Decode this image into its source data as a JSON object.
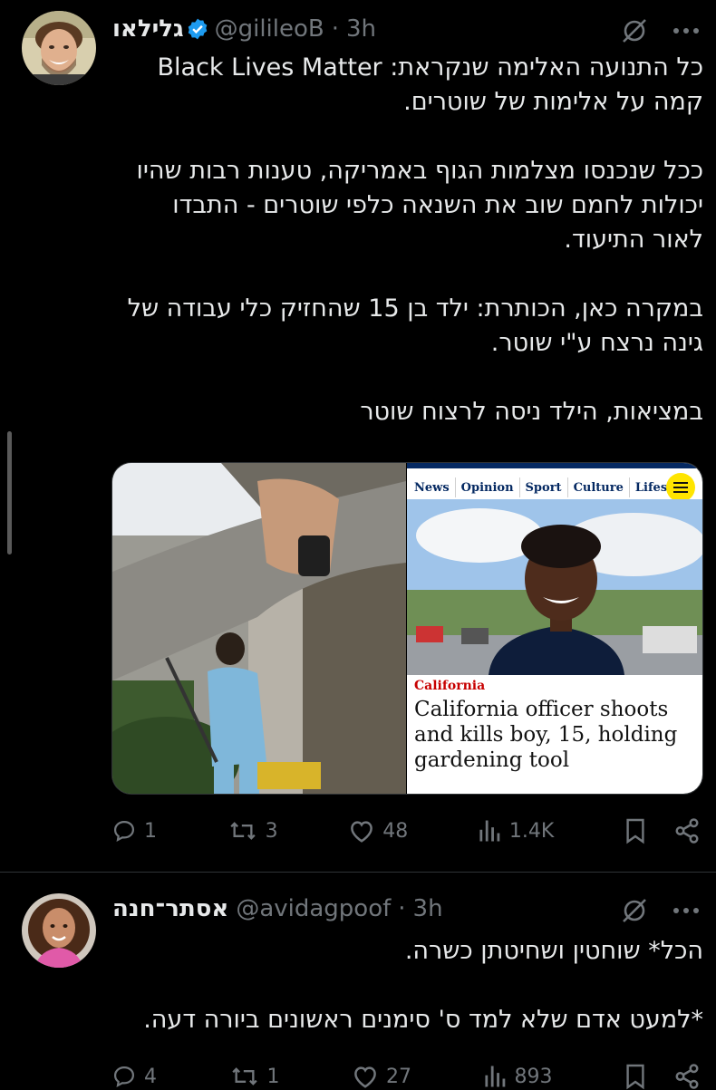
{
  "tweet1": {
    "name": "גלילאו",
    "handle": "@gilileoB",
    "separator": "·",
    "time": "3h",
    "text": "כל התנועה האלימה שנקראת: Black Lives Matter\nקמה על אלימות של שוטרים.\n\nככל שנכנסו מצלמות הגוף באמריקה, טענות רבות שהיו\nיכולות לחמם שוב את השנאה כלפי שוטרים - התבדו\nלאור התיעוד.\n\nבמקרה כאן, הכותרת: ילד בן 15 שהחזיק כלי עבודה של\nגינה נרצח ע\"י שוטר.\n\nבמציאות, הילד ניסה לרצוח שוטר",
    "media": {
      "nav": [
        "News",
        "Opinion",
        "Sport",
        "Culture",
        "Lifestyle"
      ],
      "section": "California",
      "headline": "California officer shoots and kills boy, 15, holding gardening tool"
    },
    "actions": {
      "replies": "1",
      "reposts": "3",
      "likes": "48",
      "views": "1.4K"
    }
  },
  "tweet2": {
    "name": "אסתר־חנה",
    "handle": "@avidagpoof",
    "separator": "·",
    "time": "3h",
    "text": "הכל* שוחטין ושחיטתן כשרה.\n\n*למעט אדם שלא למד ס' סימנים ראשונים ביורה דעה.",
    "actions": {
      "replies": "4",
      "reposts": "1",
      "likes": "27",
      "views": "893"
    }
  },
  "colors": {
    "background": "#000000",
    "text": "#e7e9ea",
    "secondary": "#71767b",
    "verified": "#1d9bf0",
    "divider": "#2f3336"
  },
  "icons": [
    "verified-badge-icon",
    "grok-icon",
    "more-icon",
    "reply-icon",
    "repost-icon",
    "like-icon",
    "views-icon",
    "bookmark-icon",
    "share-icon",
    "menu-icon"
  ]
}
